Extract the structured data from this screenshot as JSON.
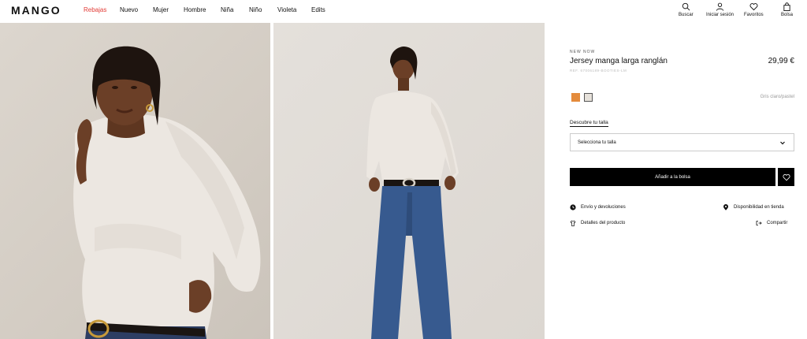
{
  "header": {
    "logo": "MANGO",
    "nav": [
      "Rebajas",
      "Nuevo",
      "Mujer",
      "Hombre",
      "Niña",
      "Niño",
      "Violeta",
      "Edits"
    ],
    "actions": {
      "search": "Buscar",
      "login": "Iniciar sesión",
      "favorites": "Favoritos",
      "bag": "Bolsa"
    },
    "sale_color": "#e23b36"
  },
  "product": {
    "tag": "NEW NOW",
    "title": "Jersey manga larga ranglán",
    "price": "29,99 €",
    "ref": "REF. 67006189-BOOTIES-LM",
    "colors": [
      {
        "name": "naranja",
        "hex": "#e48b3c",
        "selected": false
      },
      {
        "name": "Gris claro/pastel",
        "hex": "#e6e1da",
        "selected": true
      }
    ],
    "selected_color_name": "Gris claro/pastel",
    "size_guide_link": "Descubre tu talla",
    "size_select_placeholder": "Selecciona tu talla",
    "add_to_bag": "Añadir a la bolsa",
    "links": {
      "shipping": "Envío y devoluciones",
      "availability": "Disponibilidad en tienda",
      "details": "Detalles del producto",
      "share": "Compartir"
    }
  }
}
